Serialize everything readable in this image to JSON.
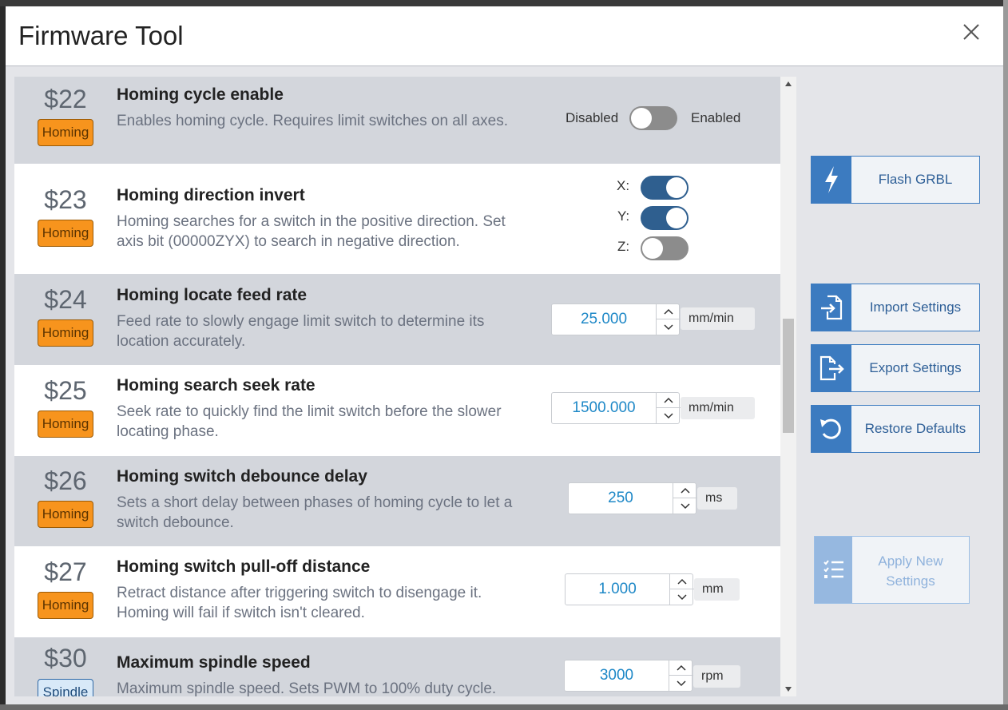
{
  "modal": {
    "title": "Firmware Tool"
  },
  "settings": [
    {
      "code": "$22",
      "category": "Homing",
      "name": "Homing cycle enable",
      "description": "Enables homing cycle. Requires limit switches on all axes.",
      "control": "toggle",
      "off_label": "Disabled",
      "on_label": "Enabled",
      "state": "off"
    },
    {
      "code": "$23",
      "category": "Homing",
      "name": "Homing direction invert",
      "description": "Homing searches for a switch in the positive direction. Set axis bit (00000ZYX) to search in negative direction.",
      "control": "axis-toggles",
      "axes": [
        {
          "label": "X:",
          "state": "on"
        },
        {
          "label": "Y:",
          "state": "on"
        },
        {
          "label": "Z:",
          "state": "off"
        }
      ]
    },
    {
      "code": "$24",
      "category": "Homing",
      "name": "Homing locate feed rate",
      "description": "Feed rate to slowly engage limit switch to determine its location accurately.",
      "control": "number",
      "value": "25.000",
      "unit": "mm/min"
    },
    {
      "code": "$25",
      "category": "Homing",
      "name": "Homing search seek rate",
      "description": "Seek rate to quickly find the limit switch before the slower locating phase.",
      "control": "number",
      "value": "1500.000",
      "unit": "mm/min"
    },
    {
      "code": "$26",
      "category": "Homing",
      "name": "Homing switch debounce delay",
      "description": "Sets a short delay between phases of homing cycle to let a switch debounce.",
      "control": "number",
      "value": "250",
      "unit": "ms"
    },
    {
      "code": "$27",
      "category": "Homing",
      "name": "Homing switch pull-off distance",
      "description": "Retract distance after triggering switch to disengage it. Homing will fail if switch isn't cleared.",
      "control": "number",
      "value": "1.000",
      "unit": "mm"
    },
    {
      "code": "$30",
      "category": "Spindle",
      "name": "Maximum spindle speed",
      "description": "Maximum spindle speed. Sets PWM to 100% duty cycle.",
      "control": "number",
      "value": "3000",
      "unit": "rpm"
    }
  ],
  "actions": {
    "flash": "Flash GRBL",
    "import": "Import Settings",
    "export": "Export Settings",
    "restore": "Restore Defaults",
    "apply": "Apply New Settings"
  },
  "colors": {
    "accent": "#3c7bc0",
    "homing_badge": "#f7941d",
    "toggle_on": "#2f5f8f",
    "toggle_off": "#8c8c8c",
    "value_text": "#1e88c7"
  },
  "icons": {
    "close": "close-icon",
    "flash": "lightning-icon",
    "import": "file-import-icon",
    "export": "file-export-icon",
    "restore": "restore-icon",
    "apply": "checklist-icon"
  }
}
